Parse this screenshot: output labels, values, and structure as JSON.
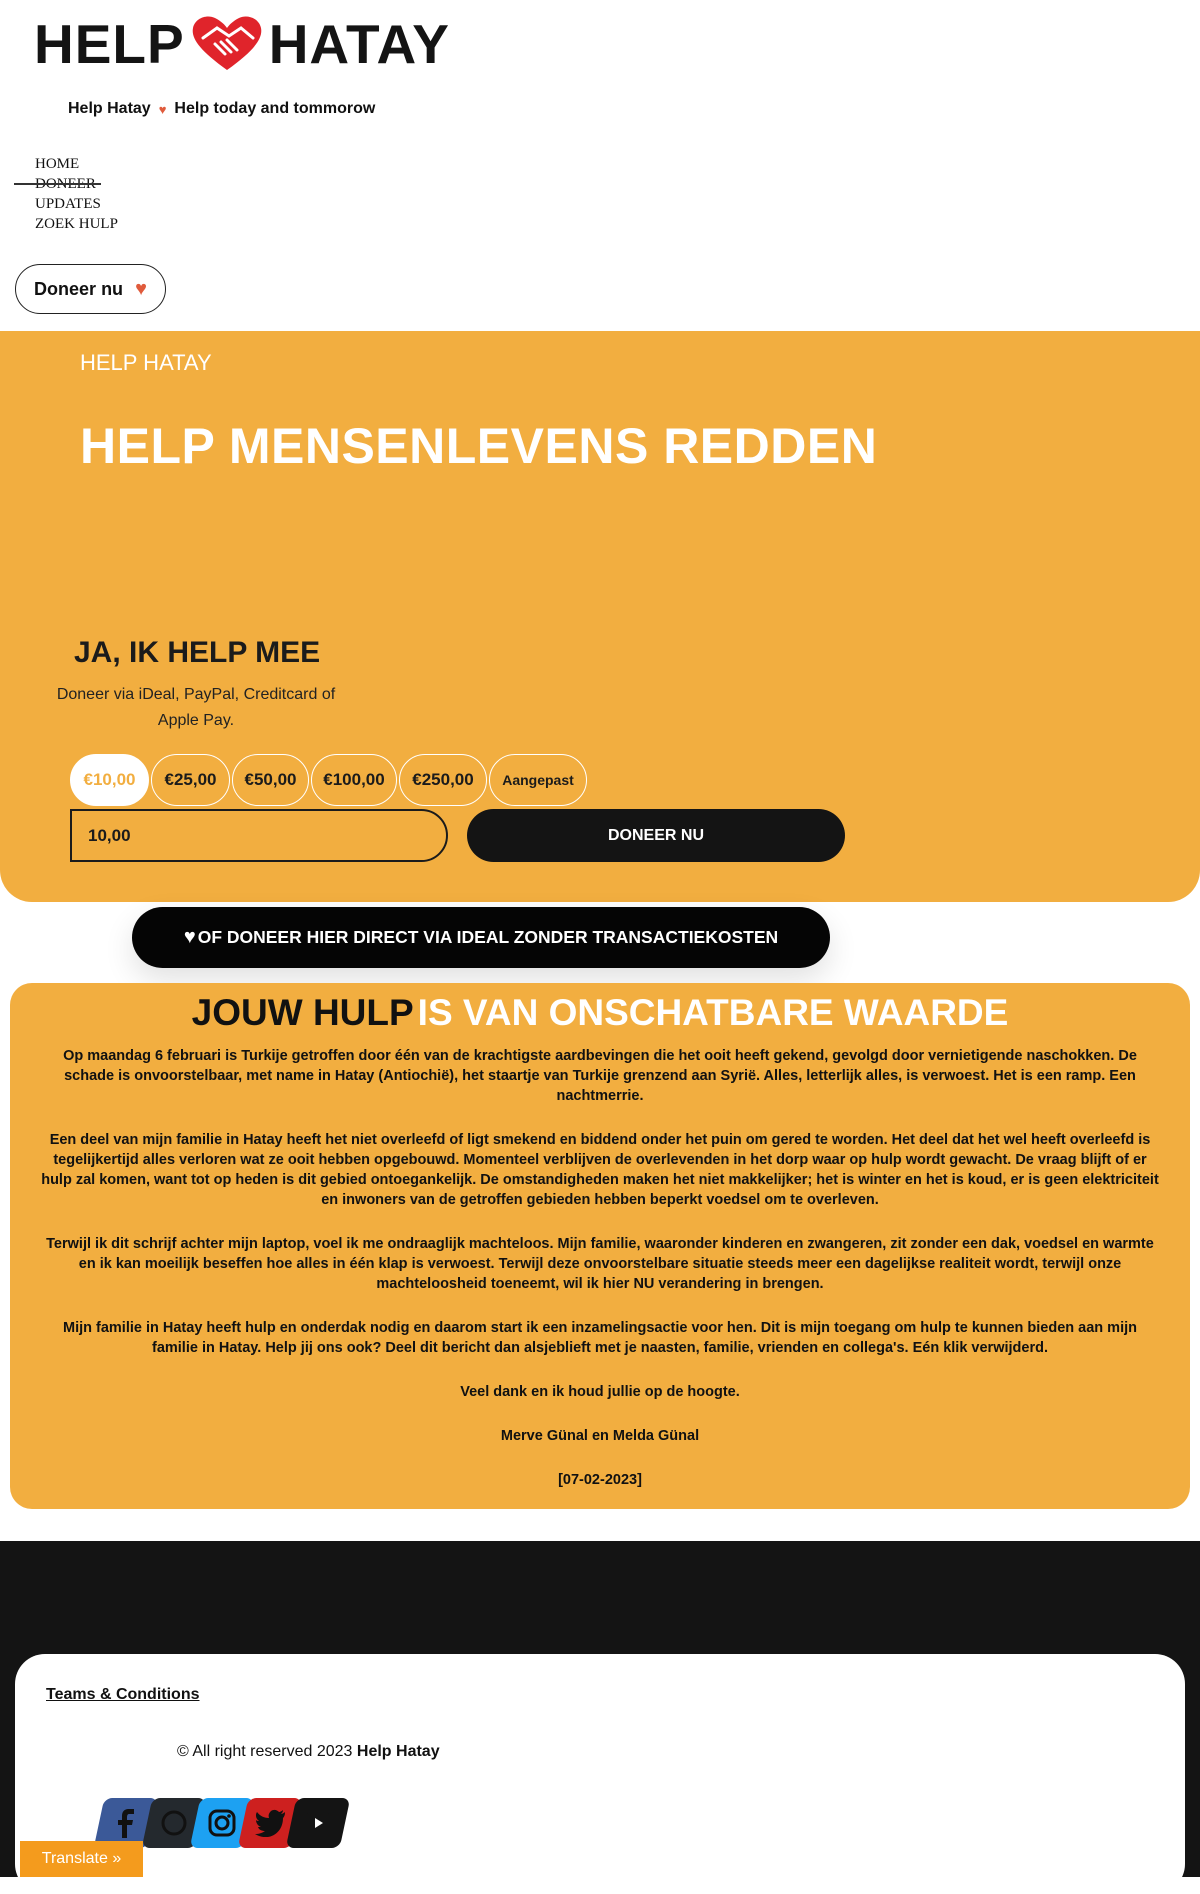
{
  "header": {
    "logo_left": "HELP",
    "logo_right": "HATAY",
    "tagline_left": "Help Hatay",
    "tagline_right": "Help today and tommorow",
    "nav": [
      "HOME",
      "DONEER",
      "UPDATES",
      "ZOEK HULP"
    ],
    "donate_button": "Doneer nu"
  },
  "hero": {
    "kicker": "HELP HATAY",
    "title": "HELP MENSENLEVENS REDDEN",
    "form_title": "JA, IK HELP MEE",
    "form_subtitle": "Doneer via iDeal, PayPal, Creditcard of Apple Pay.",
    "amounts": [
      "€10,00",
      "€25,00",
      "€50,00",
      "€100,00",
      "€250,00",
      "Aangepast"
    ],
    "selected_amount": "€10,00",
    "amount_value": "10,00",
    "submit_label": "DONEER NU"
  },
  "ideal_button": "OF DONEER HIER DIRECT VIA IDEAL ZONDER TRANSACTIEKOSTEN",
  "story": {
    "title_dark": "JOUW HULP",
    "title_light": "IS VAN ONSCHATBARE WAARDE",
    "paragraphs": [
      "Op maandag 6 februari is Turkije getroffen door één van de krachtigste aardbevingen die het ooit heeft gekend, gevolgd door vernietigende naschokken. De schade is onvoorstelbaar, met name in Hatay (Antiochië), het staartje van Turkije grenzend aan Syrië. Alles, letterlijk alles, is verwoest. Het is een ramp. Een nachtmerrie.",
      "Een deel van mijn familie in Hatay heeft het niet overleefd of ligt smekend en biddend onder het puin om gered te worden. Het deel dat het wel heeft overleefd is tegelijkertijd alles verloren wat ze ooit hebben opgebouwd. Momenteel verblijven de overlevenden in het dorp waar op hulp wordt gewacht. De vraag blijft of er hulp zal komen, want tot op heden is dit gebied ontoegankelijk. De omstandigheden maken het niet makkelijker; het is winter en het is koud, er is geen elektriciteit en inwoners van de getroffen gebieden hebben beperkt voedsel om te overleven.",
      "Terwijl ik dit schrijf achter mijn laptop, voel ik me ondraaglijk machteloos. Mijn familie, waaronder kinderen en zwangeren, zit zonder een dak, voedsel en warmte en ik kan moeilijk beseffen hoe alles in één klap is verwoest. Terwijl deze onvoorstelbare situatie steeds meer een dagelijkse realiteit wordt, terwijl onze machteloosheid toeneemt, wil ik hier NU verandering in brengen.",
      "Mijn familie in Hatay heeft hulp en onderdak nodig en daarom start ik een inzamelingsactie voor hen. Dit is mijn toegang om hulp te kunnen bieden aan mijn familie in Hatay. Help jij ons ook? Deel dit bericht dan alsjeblieft met je naasten, familie, vrienden en collega's. Eén klik verwijderd.",
      "Veel dank en ik houd jullie op de hoogte.",
      "Merve Günal en Melda Günal",
      "[07-02-2023]"
    ]
  },
  "footer": {
    "terms": "Teams & Conditions",
    "copyright_prefix": "© All right reserved 2023",
    "copyright_brand": "Help Hatay",
    "social": [
      {
        "name": "facebook-icon",
        "color": "#3b5998"
      },
      {
        "name": "github-icon",
        "color": "#24292e"
      },
      {
        "name": "instagram-icon",
        "color": "#1da1f2"
      },
      {
        "name": "twitter-icon",
        "color": "#cd201f"
      },
      {
        "name": "youtube-icon",
        "color": "#141414"
      }
    ]
  },
  "translate_button": "Translate »",
  "colors": {
    "accent": "#f2ae40",
    "heart": "#e05b3c",
    "dark": "#141414",
    "translate": "#f49b1d"
  }
}
